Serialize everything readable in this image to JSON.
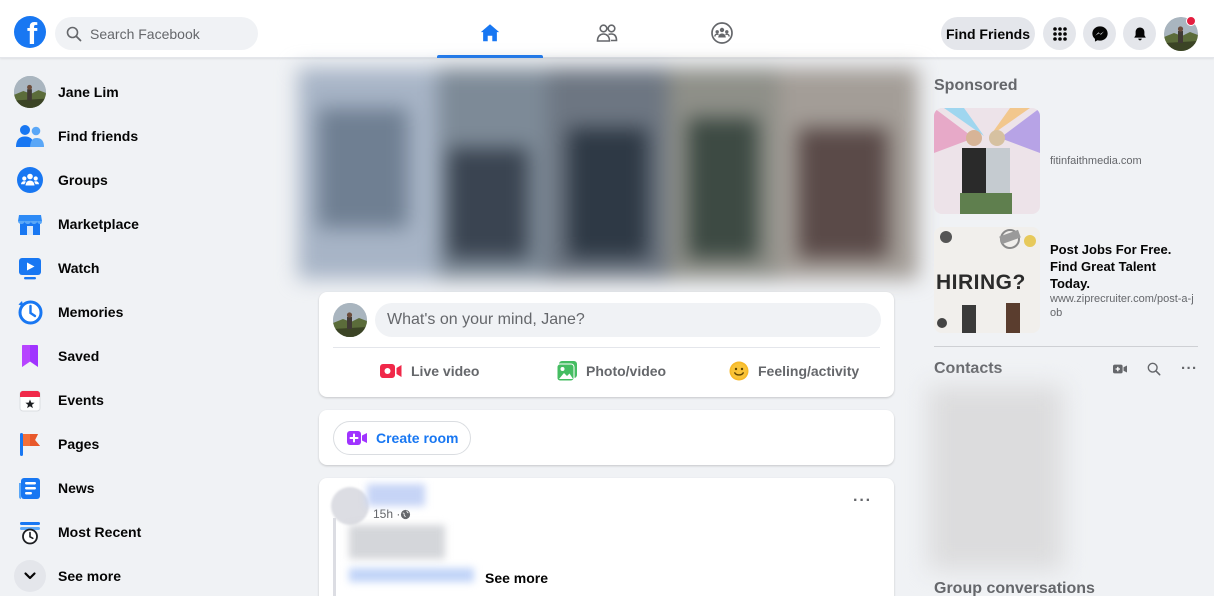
{
  "header": {
    "logo_letter": "f",
    "search_placeholder": "Search Facebook",
    "nav_tabs": [
      {
        "name": "home",
        "active": true
      },
      {
        "name": "friends",
        "active": false
      },
      {
        "name": "groups",
        "active": false
      }
    ],
    "find_friends_label": "Find Friends",
    "accent_color": "#1877f2",
    "notification_dot": true
  },
  "sidebar": {
    "items": [
      {
        "label": "Jane Lim",
        "icon": "profile-avatar"
      },
      {
        "label": "Find friends",
        "icon": "friends-icon"
      },
      {
        "label": "Groups",
        "icon": "groups-icon"
      },
      {
        "label": "Marketplace",
        "icon": "marketplace-icon"
      },
      {
        "label": "Watch",
        "icon": "watch-icon"
      },
      {
        "label": "Memories",
        "icon": "memories-icon"
      },
      {
        "label": "Saved",
        "icon": "saved-icon"
      },
      {
        "label": "Events",
        "icon": "events-icon"
      },
      {
        "label": "Pages",
        "icon": "pages-icon"
      },
      {
        "label": "News",
        "icon": "news-icon"
      },
      {
        "label": "Most Recent",
        "icon": "most-recent-icon"
      },
      {
        "label": "See more",
        "icon": "chevron-down-icon"
      }
    ]
  },
  "composer": {
    "prompt": "What's on your mind, Jane?",
    "actions": [
      {
        "label": "Live video",
        "icon": "live-video-icon",
        "color": "#f02849"
      },
      {
        "label": "Photo/video",
        "icon": "photo-video-icon",
        "color": "#45bd62"
      },
      {
        "label": "Feeling/activity",
        "icon": "feeling-icon",
        "color": "#f7b928"
      }
    ]
  },
  "room": {
    "create_room_label": "Create room"
  },
  "post": {
    "time": "15h · ",
    "see_more": "See more",
    "more_menu": "···"
  },
  "right_rail": {
    "sponsored_heading": "Sponsored",
    "ads": [
      {
        "title": "",
        "url": "fitinfaithmedia.com"
      },
      {
        "title": "Post Jobs For Free. Find Great Talent Today.",
        "url": "www.ziprecruiter.com/post-a-job",
        "thumb_text": "HIRING?"
      }
    ],
    "contacts_heading": "Contacts",
    "contacts_more": "···",
    "group_conversations_heading": "Group conversations"
  }
}
